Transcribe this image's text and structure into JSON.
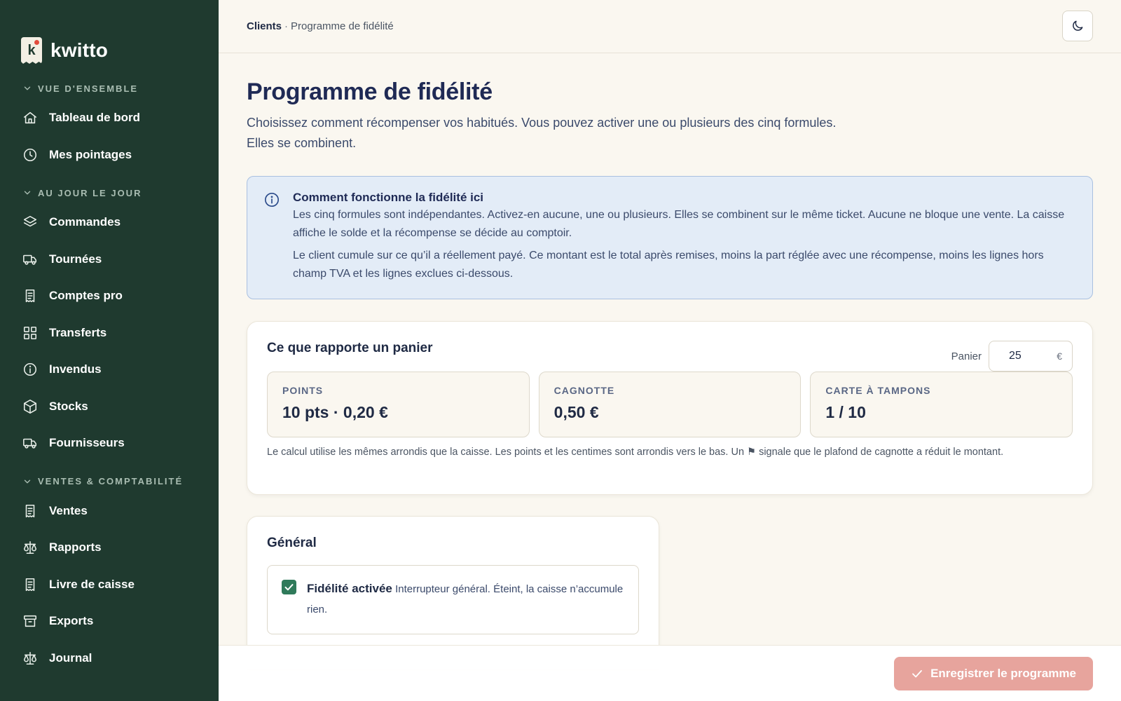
{
  "brand": {
    "name": "kwitto",
    "logo_letter": "k"
  },
  "sidebar": {
    "sections": [
      {
        "title": "VUE D'ENSEMBLE",
        "items": [
          {
            "label": "Tableau de bord",
            "icon": "home-icon"
          },
          {
            "label": "Mes pointages",
            "icon": "clock-icon"
          }
        ]
      },
      {
        "title": "AU JOUR LE JOUR",
        "items": [
          {
            "label": "Commandes",
            "icon": "layers-icon"
          },
          {
            "label": "Tournées",
            "icon": "truck-icon"
          },
          {
            "label": "Comptes pro",
            "icon": "receipt-icon"
          },
          {
            "label": "Transferts",
            "icon": "grid-icon"
          },
          {
            "label": "Invendus",
            "icon": "info-icon"
          },
          {
            "label": "Stocks",
            "icon": "box-icon"
          },
          {
            "label": "Fournisseurs",
            "icon": "truck-icon"
          }
        ]
      },
      {
        "title": "VENTES & COMPTABILITÉ",
        "items": [
          {
            "label": "Ventes",
            "icon": "receipt-icon"
          },
          {
            "label": "Rapports",
            "icon": "scale-icon"
          },
          {
            "label": "Livre de caisse",
            "icon": "receipt-icon"
          },
          {
            "label": "Exports",
            "icon": "archive-icon"
          },
          {
            "label": "Journal",
            "icon": "scale-icon"
          }
        ]
      }
    ]
  },
  "breadcrumb": {
    "parent": "Clients",
    "separator": "·",
    "current": "Programme de fidélité"
  },
  "page": {
    "title": "Programme de fidélité",
    "subtitle": "Choisissez comment récompenser vos habitués. Vous pouvez activer une ou plusieurs des cinq formules. Elles se combinent."
  },
  "info": {
    "title": "Comment fonctionne la fidélité ici",
    "p1": "Les cinq formules sont indépendantes. Activez-en aucune, une ou plusieurs. Elles se combinent sur le même ticket. Aucune ne bloque une vente. La caisse affiche le solde et la récompense se décide au comptoir.",
    "p2": "Le client cumule sur ce qu’il a réellement payé. Ce montant est le total après remises, moins la part réglée avec une récompense, moins les lignes hors champ TVA et les lignes exclues ci-dessous."
  },
  "basket": {
    "title": "Ce que rapporte un panier",
    "input_label": "Panier",
    "input_value": "25",
    "input_unit": "€",
    "stats": [
      {
        "label": "POINTS",
        "value": "10 pts · 0,20 €"
      },
      {
        "label": "CAGNOTTE",
        "value": "0,50 €"
      },
      {
        "label": "CARTE À TAMPONS",
        "value": "1 / 10"
      }
    ],
    "note": "Le calcul utilise les mêmes arrondis que la caisse. Les points et les centimes sont arrondis vers le bas. Un ⚑ signale que le plafond de cagnotte a réduit le montant."
  },
  "general": {
    "title": "Général",
    "toggle_label": "Fidélité activée",
    "toggle_desc": "Interrupteur général. Éteint, la caisse n’accumule rien.",
    "toggle_checked": true
  },
  "footer": {
    "save_label": "Enregistrer le programme"
  },
  "colors": {
    "sidebar_bg": "#1f3a2f",
    "accent": "#2f7a5a",
    "save_button": "#e7a49d",
    "info_bg": "#e3ecf7"
  }
}
